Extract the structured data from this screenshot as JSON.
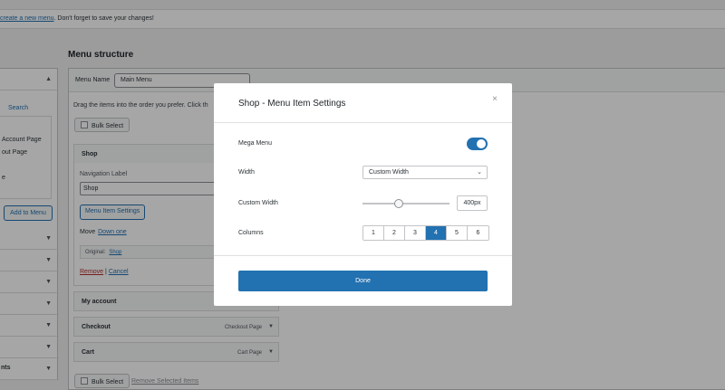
{
  "notice": {
    "link": "create a new menu",
    "text": ". Don't forget to save your changes!"
  },
  "heading": "Menu structure",
  "left_panel": {
    "search_tab": "Search",
    "items": [
      "Account Page",
      "out Page",
      "e"
    ],
    "add_button": "Add to Menu",
    "footer": "nts"
  },
  "menu": {
    "name_label": "Menu Name",
    "name_value": "Main Menu",
    "drag_text": "Drag the items into the order you prefer. Click th",
    "bulk_select": "Bulk Select",
    "remove_selected": "Remove Selected Items",
    "shop": {
      "title": "Shop",
      "nav_label": "Navigation Label",
      "nav_value": "Shop",
      "settings_button": "Menu Item Settings",
      "move_label": "Move",
      "move_link": "Down one",
      "original_label": "Original:",
      "original_link": "Shop",
      "remove": "Remove",
      "separator": "|",
      "cancel": "Cancel"
    },
    "items": [
      {
        "title": "My account",
        "type": ""
      },
      {
        "title": "Checkout",
        "type": "Checkout Page"
      },
      {
        "title": "Cart",
        "type": "Cart Page"
      }
    ]
  },
  "modal": {
    "title": "Shop - Menu Item Settings",
    "close_glyph": "×",
    "mega_menu_label": "Mega Menu",
    "mega_menu_on": true,
    "width_label": "Width",
    "width_value": "Custom Width",
    "custom_width_label": "Custom Width",
    "custom_width_value": "400px",
    "slider_fraction": 0.42,
    "columns_label": "Columns",
    "columns_options": [
      "1",
      "2",
      "3",
      "4",
      "5",
      "6"
    ],
    "columns_selected": "4",
    "done_button": "Done"
  },
  "colors": {
    "accent": "#2271b1",
    "danger": "#b32d2e"
  }
}
